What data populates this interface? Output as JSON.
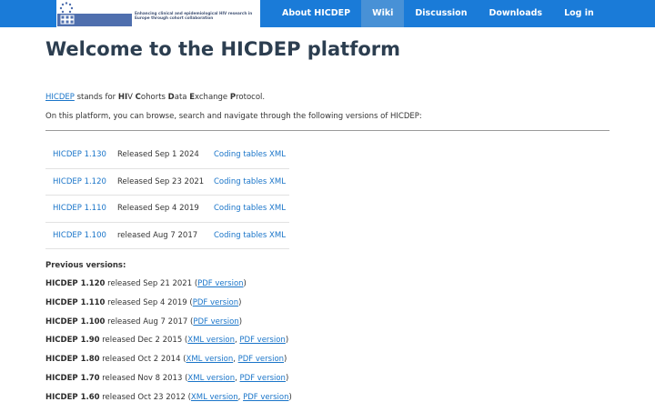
{
  "nav": {
    "logo": {
      "name": "EuroCoord",
      "tagline": "Enhancing clinical and epidemiological HIV research in Europe through cohort collaboration"
    },
    "items": [
      {
        "label": "About HICDEP",
        "active": false
      },
      {
        "label": "Wiki",
        "active": true
      },
      {
        "label": "Discussion",
        "active": false
      },
      {
        "label": "Downloads",
        "active": false
      },
      {
        "label": "Log in",
        "active": false
      }
    ]
  },
  "main": {
    "title": "Welcome to the HICDEP platform",
    "intro": {
      "acronym_link": "HICDEP",
      "stands_for": " stands for ",
      "expansion": [
        {
          "bold": "HI",
          "rest": "V "
        },
        {
          "bold": "C",
          "rest": "ohorts "
        },
        {
          "bold": "D",
          "rest": "ata "
        },
        {
          "bold": "E",
          "rest": "xchange "
        },
        {
          "bold": "P",
          "rest": "rotocol."
        }
      ]
    },
    "browse_text": "On this platform, you can browse, search and navigate through the following versions of HICDEP:",
    "versions": [
      {
        "name": "HICDEP 1.130",
        "released": "Released Sep 1 2024",
        "link": "Coding tables XML"
      },
      {
        "name": "HICDEP 1.120",
        "released": "Released Sep 23 2021",
        "link": "Coding tables XML"
      },
      {
        "name": "HICDEP 1.110",
        "released": "Released Sep 4 2019",
        "link": "Coding tables XML"
      },
      {
        "name": "HICDEP 1.100",
        "released": "released Aug 7 2017",
        "link": "Coding tables XML"
      }
    ],
    "previous_heading": "Previous versions:",
    "previous": [
      {
        "name": "HICDEP 1.120",
        "released": " released Sep 21 2021 (",
        "links": [
          "PDF version"
        ],
        "close": ")"
      },
      {
        "name": "HICDEP 1.110",
        "released": " released Sep 4 2019 (",
        "links": [
          "PDF version"
        ],
        "close": ")"
      },
      {
        "name": "HICDEP 1.100",
        "released": " released Aug 7 2017 (",
        "links": [
          "PDF version"
        ],
        "close": ")"
      },
      {
        "name": "HICDEP 1.90",
        "released": " released Dec 2 2015 (",
        "links": [
          "XML version",
          "PDF version"
        ],
        "close": ")"
      },
      {
        "name": "HICDEP 1.80",
        "released": " released Oct 2 2014 (",
        "links": [
          "XML version",
          "PDF version"
        ],
        "close": ")"
      },
      {
        "name": "HICDEP 1.70",
        "released": " released Nov 8 2013 (",
        "links": [
          "XML version",
          "PDF version"
        ],
        "close": ")"
      },
      {
        "name": "HICDEP 1.60",
        "released": " released Oct 23 2012 (",
        "links": [
          "XML version",
          "PDF version"
        ],
        "close": ")"
      }
    ],
    "separator": ", "
  }
}
